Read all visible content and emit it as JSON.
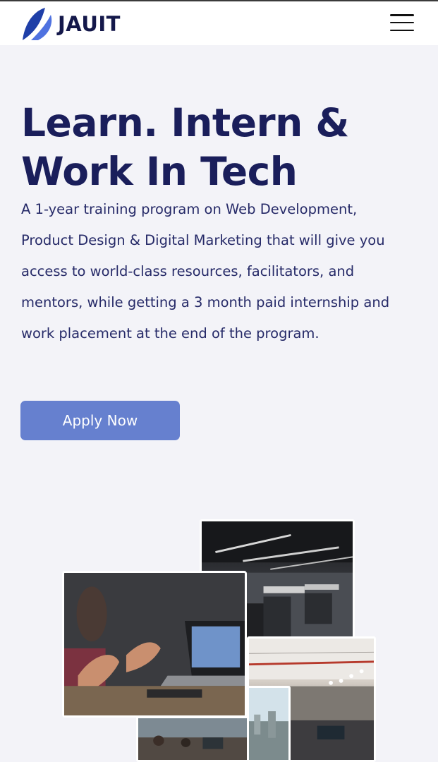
{
  "header": {
    "brand": "JAUIT",
    "logo_icon": "feather-leaf-logo",
    "menu_icon": "hamburger-menu-icon"
  },
  "hero": {
    "title_line1": "Learn. Intern &",
    "title_line2": "Work In Tech",
    "description_lines": [
      "A 1-year training program on Web Development,",
      "Product Design & Digital Marketing that will give you",
      "access to world-class resources, facilitators, and",
      "mentors, while getting a 3 month paid internship and",
      "work placement at the end of the program."
    ],
    "cta_label": "Apply Now"
  },
  "colors": {
    "background": "#f3f3f8",
    "header_bg": "#ffffff",
    "title": "#1a1e5b",
    "cta_bg": "#6680cf",
    "logo_blue_dark": "#1f3fa8",
    "logo_blue_light": "#4f72e0"
  }
}
